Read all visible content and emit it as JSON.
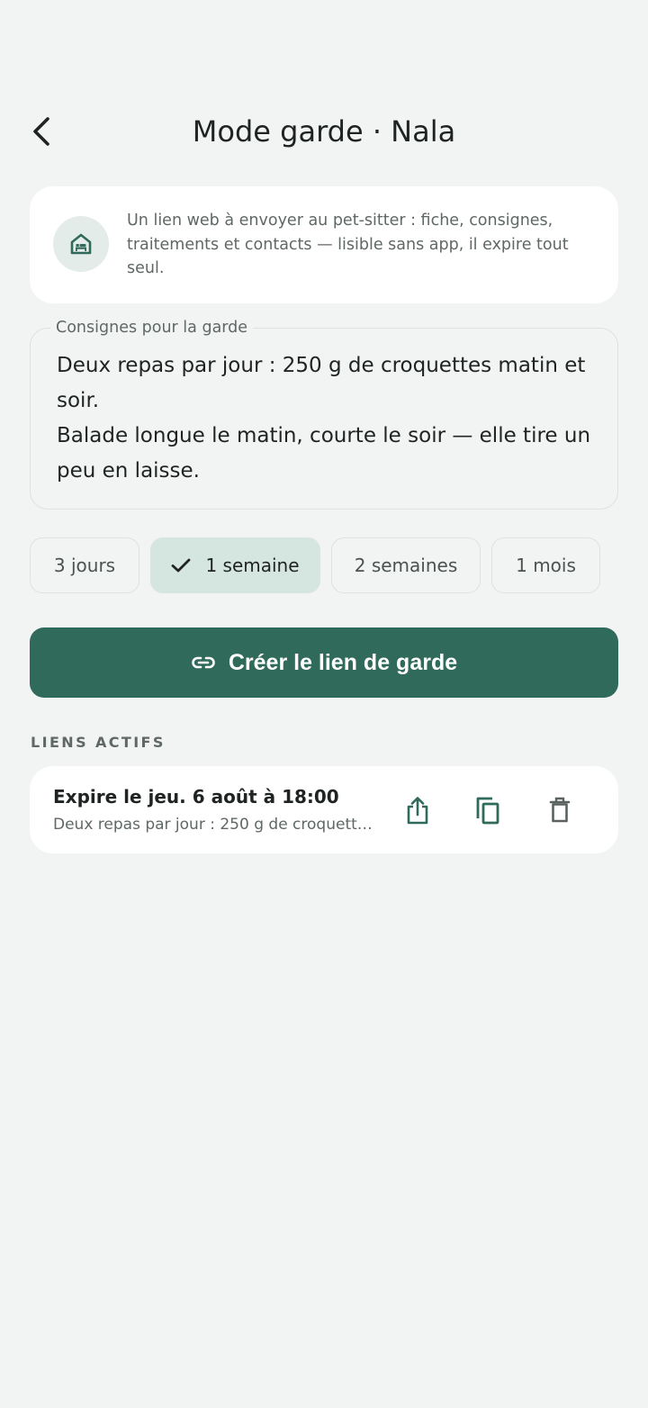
{
  "header": {
    "title": "Mode garde · Nala",
    "back_icon": "chevron-left-icon"
  },
  "info": {
    "icon": "house-bed-icon",
    "text": "Un lien web à envoyer au pet-sitter : fiche, consignes, traitements et contacts — lisible sans app, il expire tout seul."
  },
  "instructions": {
    "label": "Consignes pour la garde",
    "value": "Deux repas par jour : 250 g de croquettes matin et soir.\nBalade longue le matin, courte le soir — elle tire un peu en laisse."
  },
  "durations": {
    "options": [
      "3 jours",
      "1 semaine",
      "2 semaines",
      "1 mois"
    ],
    "selected": "1 semaine"
  },
  "create_button": {
    "label": "Créer le lien de garde",
    "icon": "link-icon"
  },
  "active_links": {
    "section_title": "LIENS ACTIFS",
    "items": [
      {
        "title": "Expire le jeu. 6 août à 18:00",
        "subtitle": "Deux repas par jour : 250 g de croquettes matin et soir.",
        "actions": [
          "share-icon",
          "copy-icon",
          "delete-icon"
        ]
      }
    ]
  },
  "colors": {
    "background": "#f2f4f3",
    "primary": "#306a5a",
    "chip_selected": "#d4e6df",
    "card": "#ffffff"
  }
}
